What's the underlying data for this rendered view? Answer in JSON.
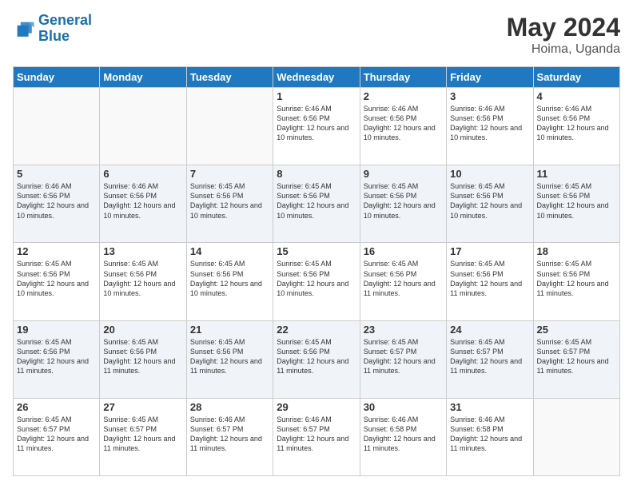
{
  "header": {
    "logo_line1": "General",
    "logo_line2": "Blue",
    "title": "May 2024",
    "subtitle": "Hoima, Uganda"
  },
  "days_of_week": [
    "Sunday",
    "Monday",
    "Tuesday",
    "Wednesday",
    "Thursday",
    "Friday",
    "Saturday"
  ],
  "weeks": [
    [
      {
        "day": "",
        "info": ""
      },
      {
        "day": "",
        "info": ""
      },
      {
        "day": "",
        "info": ""
      },
      {
        "day": "1",
        "info": "Sunrise: 6:46 AM\nSunset: 6:56 PM\nDaylight: 12 hours and 10 minutes."
      },
      {
        "day": "2",
        "info": "Sunrise: 6:46 AM\nSunset: 6:56 PM\nDaylight: 12 hours and 10 minutes."
      },
      {
        "day": "3",
        "info": "Sunrise: 6:46 AM\nSunset: 6:56 PM\nDaylight: 12 hours and 10 minutes."
      },
      {
        "day": "4",
        "info": "Sunrise: 6:46 AM\nSunset: 6:56 PM\nDaylight: 12 hours and 10 minutes."
      }
    ],
    [
      {
        "day": "5",
        "info": "Sunrise: 6:46 AM\nSunset: 6:56 PM\nDaylight: 12 hours and 10 minutes."
      },
      {
        "day": "6",
        "info": "Sunrise: 6:46 AM\nSunset: 6:56 PM\nDaylight: 12 hours and 10 minutes."
      },
      {
        "day": "7",
        "info": "Sunrise: 6:45 AM\nSunset: 6:56 PM\nDaylight: 12 hours and 10 minutes."
      },
      {
        "day": "8",
        "info": "Sunrise: 6:45 AM\nSunset: 6:56 PM\nDaylight: 12 hours and 10 minutes."
      },
      {
        "day": "9",
        "info": "Sunrise: 6:45 AM\nSunset: 6:56 PM\nDaylight: 12 hours and 10 minutes."
      },
      {
        "day": "10",
        "info": "Sunrise: 6:45 AM\nSunset: 6:56 PM\nDaylight: 12 hours and 10 minutes."
      },
      {
        "day": "11",
        "info": "Sunrise: 6:45 AM\nSunset: 6:56 PM\nDaylight: 12 hours and 10 minutes."
      }
    ],
    [
      {
        "day": "12",
        "info": "Sunrise: 6:45 AM\nSunset: 6:56 PM\nDaylight: 12 hours and 10 minutes."
      },
      {
        "day": "13",
        "info": "Sunrise: 6:45 AM\nSunset: 6:56 PM\nDaylight: 12 hours and 10 minutes."
      },
      {
        "day": "14",
        "info": "Sunrise: 6:45 AM\nSunset: 6:56 PM\nDaylight: 12 hours and 10 minutes."
      },
      {
        "day": "15",
        "info": "Sunrise: 6:45 AM\nSunset: 6:56 PM\nDaylight: 12 hours and 10 minutes."
      },
      {
        "day": "16",
        "info": "Sunrise: 6:45 AM\nSunset: 6:56 PM\nDaylight: 12 hours and 11 minutes."
      },
      {
        "day": "17",
        "info": "Sunrise: 6:45 AM\nSunset: 6:56 PM\nDaylight: 12 hours and 11 minutes."
      },
      {
        "day": "18",
        "info": "Sunrise: 6:45 AM\nSunset: 6:56 PM\nDaylight: 12 hours and 11 minutes."
      }
    ],
    [
      {
        "day": "19",
        "info": "Sunrise: 6:45 AM\nSunset: 6:56 PM\nDaylight: 12 hours and 11 minutes."
      },
      {
        "day": "20",
        "info": "Sunrise: 6:45 AM\nSunset: 6:56 PM\nDaylight: 12 hours and 11 minutes."
      },
      {
        "day": "21",
        "info": "Sunrise: 6:45 AM\nSunset: 6:56 PM\nDaylight: 12 hours and 11 minutes."
      },
      {
        "day": "22",
        "info": "Sunrise: 6:45 AM\nSunset: 6:56 PM\nDaylight: 12 hours and 11 minutes."
      },
      {
        "day": "23",
        "info": "Sunrise: 6:45 AM\nSunset: 6:57 PM\nDaylight: 12 hours and 11 minutes."
      },
      {
        "day": "24",
        "info": "Sunrise: 6:45 AM\nSunset: 6:57 PM\nDaylight: 12 hours and 11 minutes."
      },
      {
        "day": "25",
        "info": "Sunrise: 6:45 AM\nSunset: 6:57 PM\nDaylight: 12 hours and 11 minutes."
      }
    ],
    [
      {
        "day": "26",
        "info": "Sunrise: 6:45 AM\nSunset: 6:57 PM\nDaylight: 12 hours and 11 minutes."
      },
      {
        "day": "27",
        "info": "Sunrise: 6:45 AM\nSunset: 6:57 PM\nDaylight: 12 hours and 11 minutes."
      },
      {
        "day": "28",
        "info": "Sunrise: 6:46 AM\nSunset: 6:57 PM\nDaylight: 12 hours and 11 minutes."
      },
      {
        "day": "29",
        "info": "Sunrise: 6:46 AM\nSunset: 6:57 PM\nDaylight: 12 hours and 11 minutes."
      },
      {
        "day": "30",
        "info": "Sunrise: 6:46 AM\nSunset: 6:58 PM\nDaylight: 12 hours and 11 minutes."
      },
      {
        "day": "31",
        "info": "Sunrise: 6:46 AM\nSunset: 6:58 PM\nDaylight: 12 hours and 11 minutes."
      },
      {
        "day": "",
        "info": ""
      }
    ]
  ]
}
